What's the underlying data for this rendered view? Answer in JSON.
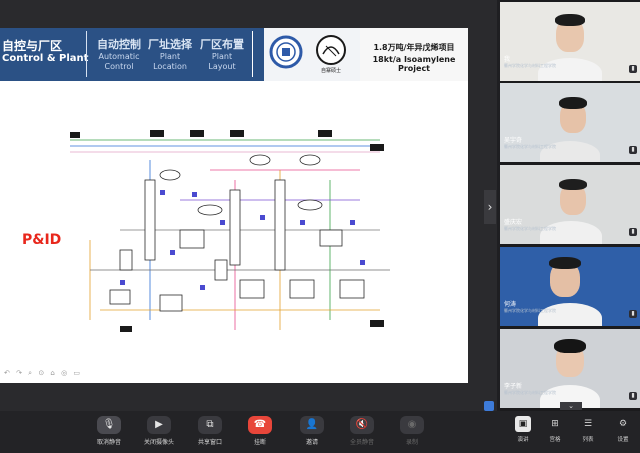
{
  "slide": {
    "banner": {
      "left_title_zh": "自控与厂区",
      "left_title_en": "Control & Plant",
      "tabs": [
        {
          "zh": "自动控制",
          "en_line1": "Automatic",
          "en_line2": "Control"
        },
        {
          "zh": "厂址选择",
          "en_line1": "Plant",
          "en_line2": "Location"
        },
        {
          "zh": "厂区布置",
          "en_line1": "Plant",
          "en_line2": "Layout"
        }
      ],
      "logo_caption": "自寨硕士",
      "project_line1": "1.8万吨/年异戊烯项目",
      "project_line2": "18kt/a Isoamylene Project"
    },
    "pid_label": "P&ID",
    "tools": "↶ ↷ ⌕ ⊙ ⌂ ◎ ▭",
    "share_chevron": "›",
    "colors": {
      "banner": "#2b5185",
      "accent_red": "#e8271c"
    }
  },
  "participants": [
    {
      "name": "我",
      "org": "衢州学院化学与材料工程学院",
      "bg": "#e9e8e4",
      "hair": "#1c1c1c",
      "skin": "#e8c7ae",
      "shirt": "#f3f3f3"
    },
    {
      "name": "吴宇奇",
      "org": "衢州学院化学与材料工程学院",
      "bg": "#d9dde0",
      "hair": "#1a1a1a",
      "skin": "#e6c2a8",
      "shirt": "#e9e9e9"
    },
    {
      "name": "盛庆宏",
      "org": "衢州学院化学与材料工程学院",
      "bg": "#dadcdc",
      "hair": "#1e1e1e",
      "skin": "#e7c4ab",
      "shirt": "#f0f0f0"
    },
    {
      "name": "何涛",
      "org": "衢州学院化学与材料工程学院",
      "bg": "#2f5fa8",
      "hair": "#1b1b1b",
      "skin": "#e4bfa5",
      "shirt": "#f2f2f2"
    },
    {
      "name": "李子新",
      "org": "衢州学院化学与材料工程学院",
      "bg": "#cfd2d6",
      "hair": "#151515",
      "skin": "#e9c8b0",
      "shirt": "#f5f5f5"
    }
  ],
  "participants_more": "⌄",
  "toolbar": {
    "buttons": [
      {
        "label": "取消静音",
        "icon": "🎙",
        "name": "unmute-button",
        "enabled": true
      },
      {
        "label": "关闭摄像头",
        "icon": "▶",
        "name": "camera-button",
        "enabled": true
      },
      {
        "label": "共享窗口",
        "icon": "⧉",
        "name": "share-window-button",
        "enabled": true
      },
      {
        "label": "挂断",
        "icon": "☎",
        "name": "hangup-button",
        "enabled": true
      },
      {
        "label": "邀请",
        "icon": "👤",
        "name": "invite-button",
        "enabled": true
      },
      {
        "label": "全员静音",
        "icon": "🔇",
        "name": "mute-all-button",
        "enabled": false
      },
      {
        "label": "录制",
        "icon": "◉",
        "name": "record-button",
        "enabled": false
      }
    ],
    "views": [
      {
        "label": "演讲",
        "icon": "▣"
      },
      {
        "label": "宫格",
        "icon": "⊞"
      },
      {
        "label": "列表",
        "icon": "☰"
      },
      {
        "label": "设置",
        "icon": "⚙"
      }
    ],
    "hangup_color": "#e8463a"
  }
}
